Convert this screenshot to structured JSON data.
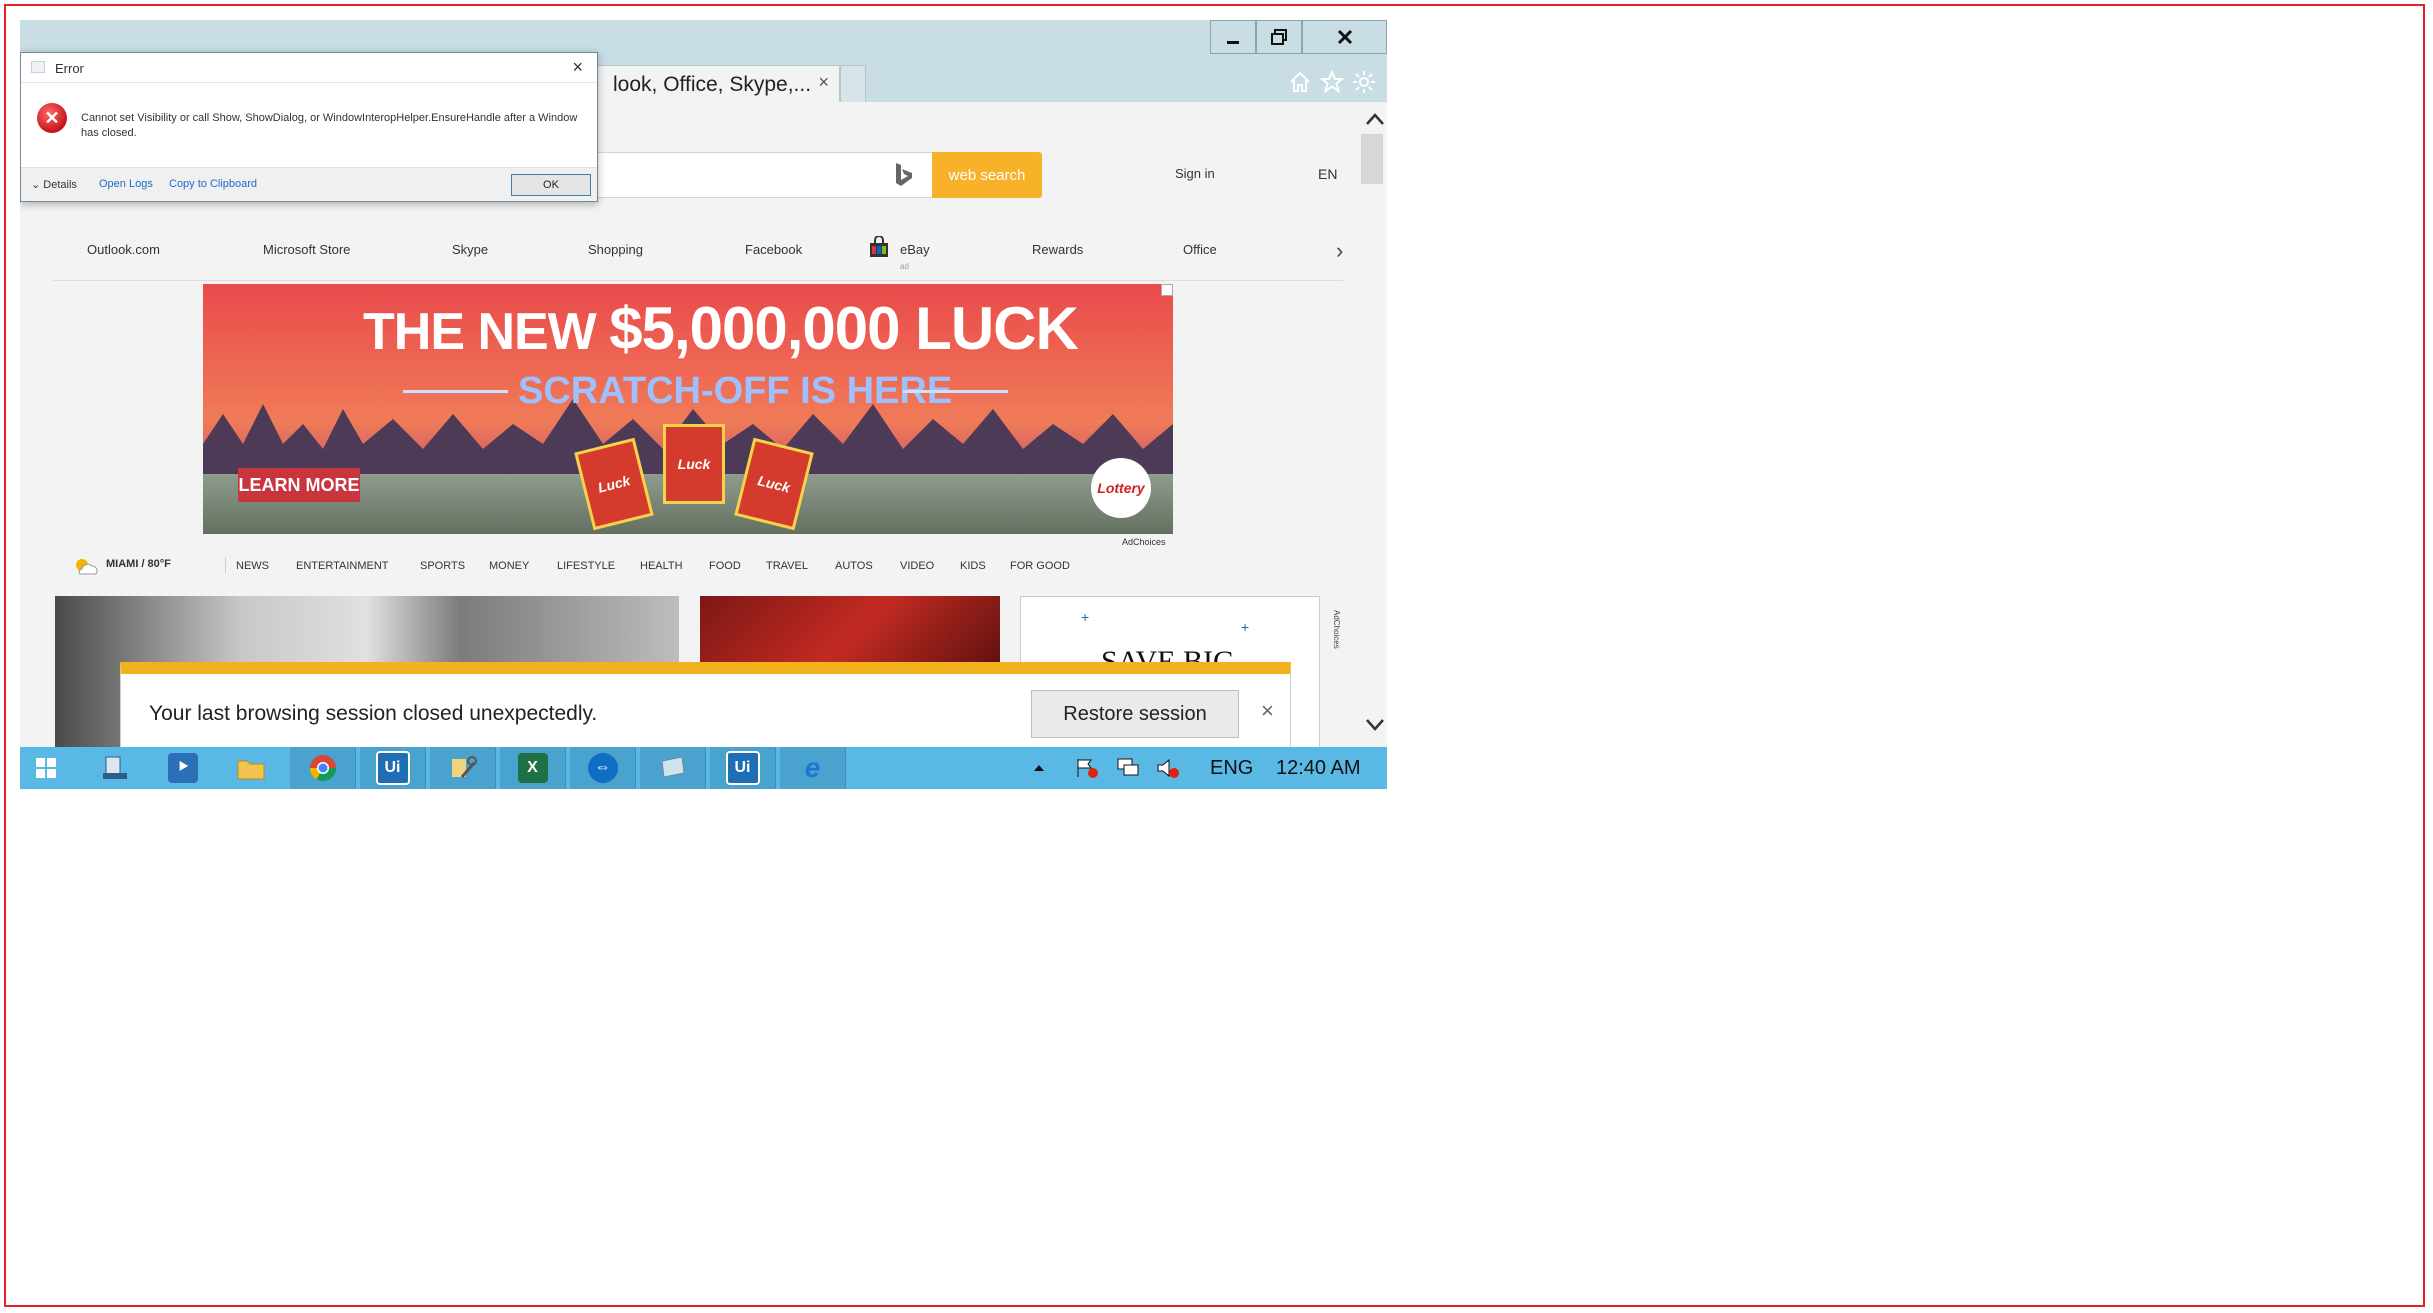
{
  "window": {
    "min_label": "▁",
    "max_label": "❐",
    "close_label": "✕",
    "tab_title": "look, Office, Skype,...",
    "tab_close": "×"
  },
  "toolbar": {
    "icons": [
      "home-icon",
      "star-icon",
      "gear-icon"
    ]
  },
  "header": {
    "search_placeholder": "",
    "search_button": "web search",
    "sign_in": "Sign in",
    "lang": "EN"
  },
  "links": [
    {
      "label": "Outlook.com"
    },
    {
      "label": "Microsoft Store"
    },
    {
      "label": "Skype"
    },
    {
      "label": "Shopping"
    },
    {
      "label": "Facebook"
    },
    {
      "label": "eBay",
      "sub": "ad"
    },
    {
      "label": "Rewards"
    },
    {
      "label": "Office"
    }
  ],
  "ad": {
    "headline_a": "THE NEW ",
    "headline_b": "$5,000,000 LUCK",
    "subline": "SCRATCH-OFF IS HERE",
    "cta": "LEARN MORE",
    "ticket_text": "Luck",
    "logo_text": "Lottery",
    "adchoices": "AdChoices"
  },
  "newsnav": {
    "weather": "MIAMI / 80°F",
    "items": [
      "NEWS",
      "ENTERTAINMENT",
      "SPORTS",
      "MONEY",
      "LIFESTYLE",
      "HEALTH",
      "FOOD",
      "TRAVEL",
      "AUTOS",
      "VIDEO",
      "KIDS",
      "FOR GOOD"
    ]
  },
  "tiles": {
    "ad_text": "SAVE BIG",
    "ad_choices_vertical": "AdChoices"
  },
  "dialog": {
    "title": "Error",
    "close": "×",
    "message": "Cannot set Visibility or call Show, ShowDialog, or WindowInteropHelper.EnsureHandle after a Window has closed.",
    "details": "Details",
    "open_logs": "Open Logs",
    "copy": "Copy to Clipboard",
    "ok": "OK"
  },
  "restore": {
    "message": "Your last browsing session closed unexpectedly.",
    "button": "Restore session",
    "close": "×"
  },
  "taskbar": {
    "apps": [
      {
        "name": "start-icon",
        "label": ""
      },
      {
        "name": "server-manager-icon",
        "label": ""
      },
      {
        "name": "powershell-icon",
        "label": "⯈"
      },
      {
        "name": "file-explorer-icon",
        "label": ""
      },
      {
        "name": "chrome-icon",
        "label": ""
      },
      {
        "name": "uipath-studio-icon",
        "label": "Ui"
      },
      {
        "name": "tools-icon",
        "label": ""
      },
      {
        "name": "excel-icon",
        "label": "X"
      },
      {
        "name": "teamviewer-icon",
        "label": "⇔"
      },
      {
        "name": "remote-desktop-icon",
        "label": ""
      },
      {
        "name": "uipath-robot-icon",
        "label": "Ui"
      },
      {
        "name": "internet-explorer-icon",
        "label": "e"
      }
    ],
    "lang": "ENG",
    "time": "12:40 AM"
  },
  "colors": {
    "accent_yellow": "#f7b22a",
    "titlebar": "#c9dde5",
    "taskbar": "#5ab9e4",
    "border_red": "#e0232b"
  }
}
